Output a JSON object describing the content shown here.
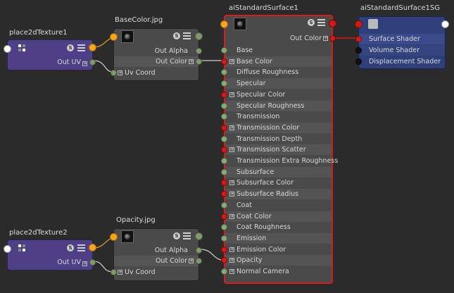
{
  "nodes": {
    "p2d1": {
      "title": "place2dTexture1",
      "out": "Out UV"
    },
    "base": {
      "title": "BaseColor.jpg",
      "out_alpha": "Out Alpha",
      "out_color": "Out Color",
      "uv": "Uv Coord"
    },
    "p2d2": {
      "title": "place2dTexture2",
      "out": "Out UV"
    },
    "opac": {
      "title": "Opacity.jpg",
      "out_alpha": "Out Alpha",
      "out_color": "Out Color",
      "uv": "Uv Coord"
    },
    "ai": {
      "title": "aiStandardSurface1",
      "out": "Out Color",
      "attrs": [
        {
          "label": "Base",
          "plug": "g",
          "expand": false
        },
        {
          "label": "Base Color",
          "plug": "r",
          "expand": true
        },
        {
          "label": "Diffuse Roughness",
          "plug": "g",
          "expand": false
        },
        {
          "label": "Specular",
          "plug": "g",
          "expand": false
        },
        {
          "label": "Specular Color",
          "plug": "r",
          "expand": true
        },
        {
          "label": "Specular Roughness",
          "plug": "g",
          "expand": false
        },
        {
          "label": "Transmission",
          "plug": "g",
          "expand": false
        },
        {
          "label": "Transmission Color",
          "plug": "r",
          "expand": true
        },
        {
          "label": "Transmission Depth",
          "plug": "g",
          "expand": false
        },
        {
          "label": "Transmission Scatter",
          "plug": "r",
          "expand": true
        },
        {
          "label": "Transmission Extra Roughness",
          "plug": "g",
          "expand": false
        },
        {
          "label": "Subsurface",
          "plug": "g",
          "expand": false
        },
        {
          "label": "Subsurface Color",
          "plug": "r",
          "expand": true
        },
        {
          "label": "Subsurface Radius",
          "plug": "r",
          "expand": true
        },
        {
          "label": "Coat",
          "plug": "g",
          "expand": false
        },
        {
          "label": "Coat Color",
          "plug": "r",
          "expand": true
        },
        {
          "label": "Coat Roughness",
          "plug": "g",
          "expand": false
        },
        {
          "label": "Emission",
          "plug": "g",
          "expand": false
        },
        {
          "label": "Emission Color",
          "plug": "r",
          "expand": true
        },
        {
          "label": "Opacity",
          "plug": "r",
          "expand": true
        },
        {
          "label": "Normal Camera",
          "plug": "g",
          "expand": true
        }
      ]
    },
    "sg": {
      "title": "aiStandardSurface1SG",
      "rows": [
        "Surface Shader",
        "Volume Shader",
        "Displacement Shader"
      ]
    }
  },
  "icons": {
    "shader_badge": "S",
    "swatch": "texture-swatch-icon",
    "menu": "hamburger-menu-icon",
    "place2d": "place2d-icon"
  },
  "colors": {
    "accent_selected": "#d81c1c",
    "place2d_node": "#4e3f86",
    "file_node": "#4a4a4a",
    "sg_node": "#2f3f7a",
    "wire": "#c8c8c8"
  }
}
